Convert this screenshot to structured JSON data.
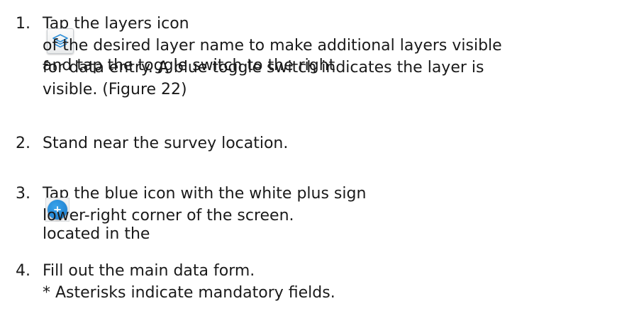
{
  "steps": [
    {
      "number": "1.",
      "lines": [
        {
          "before_icon": "Tap the layers icon",
          "icon": "layers-icon",
          "after_icon": "and tap the toggle switch to the right"
        },
        {
          "text": "of the desired layer name to make additional layers visible"
        },
        {
          "text": "for data entry. A blue toggle switch indicates the layer is"
        },
        {
          "text": "visible. (Figure 22)"
        }
      ]
    },
    {
      "number": "2.",
      "lines": [
        {
          "text": "Stand near the survey location."
        }
      ]
    },
    {
      "number": "3.",
      "lines": [
        {
          "before_icon": "Tap the blue icon with the white plus sign",
          "icon": "plus-icon",
          "after_icon": "located in the"
        },
        {
          "text": "lower-right corner of the screen."
        }
      ]
    },
    {
      "number": "4.",
      "lines": [
        {
          "text": "Fill out the main data form."
        },
        {
          "text": "* Asterisks indicate mandatory fields."
        }
      ]
    }
  ],
  "colors": {
    "text": "#1a1a1a",
    "layers_icon_stroke": "#2f8fd8",
    "plus_icon_fill": "#1f86d6"
  }
}
